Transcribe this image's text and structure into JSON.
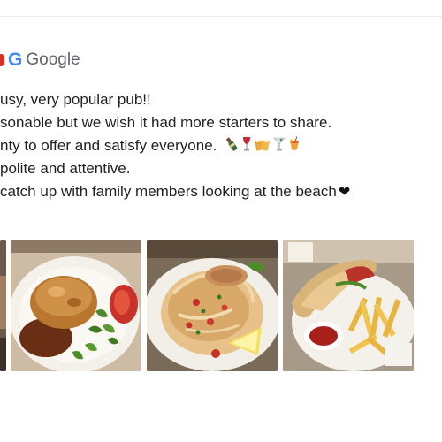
{
  "source": {
    "logo_letter": "G",
    "name": "Google",
    "colors": {
      "logo_blue": "#4285f4",
      "accent_red": "#d93025"
    }
  },
  "review": {
    "lines": [
      "usy, very popular pub!!",
      "sonable but we wish it had more starters to share.",
      "nty to offer and satisfy everyone.",
      "polite and attentive.",
      "catch up with family members looking at the beach"
    ],
    "emojis": [
      "champagne-icon",
      "wine-glass-icon",
      "beer-mugs-icon",
      "cocktail-icon",
      "tropical-drink-icon"
    ],
    "heart_glyph": "❤"
  },
  "photos": [
    {
      "name": "photo-partial-left",
      "subject": "food"
    },
    {
      "name": "photo-pie-salad",
      "subject": "pie with salad and tomato"
    },
    {
      "name": "photo-pasta-seafood",
      "subject": "seafood pasta with lemon"
    },
    {
      "name": "photo-wrap-fries",
      "subject": "wrap with fries and sauce"
    }
  ]
}
